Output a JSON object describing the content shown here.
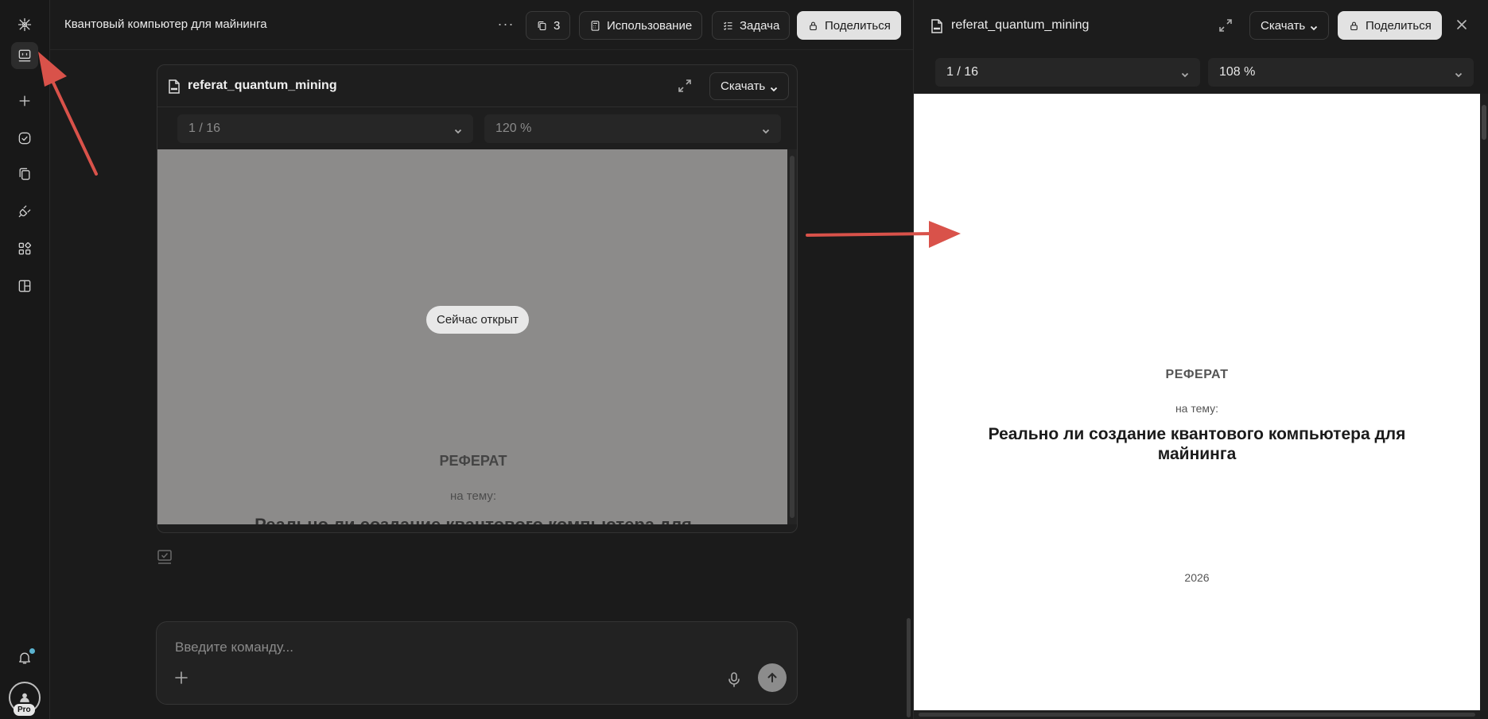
{
  "header": {
    "title": "Квантовый компьютер для майнинга",
    "more_label": "···",
    "files_count": "3",
    "usage_label": "Использование",
    "task_label": "Задача",
    "share_label": "Поделиться"
  },
  "sidebar": {
    "pro_badge": "Pro",
    "items": [
      "app-logo",
      "terminal",
      "new",
      "tasks",
      "files",
      "plugins",
      "apps",
      "layout"
    ]
  },
  "doc_card": {
    "filename": "referat_quantum_mining",
    "download_label": "Скачать",
    "page_select": "1 / 16",
    "zoom_select": "120 %",
    "now_open_badge": "Сейчас открыт",
    "preview_heading": "РЕФЕРАТ",
    "preview_subheading": "на тему:",
    "preview_title_cut": "Реально ли создание квантового компьютера для"
  },
  "command": {
    "placeholder": "Введите команду..."
  },
  "right_panel": {
    "filename": "referat_quantum_mining",
    "download_label": "Скачать",
    "share_label": "Поделиться",
    "page_select": "1 / 16",
    "zoom_select": "108 %",
    "doc": {
      "heading": "РЕФЕРАТ",
      "subheading": "на тему:",
      "title": "Реально ли создание квантового компьютера для майнинга",
      "year": "2026"
    }
  },
  "colors": {
    "background": "#1b1b1b",
    "annotation_arrow": "#d9524a",
    "notification_dot": "#5bb3d0"
  }
}
